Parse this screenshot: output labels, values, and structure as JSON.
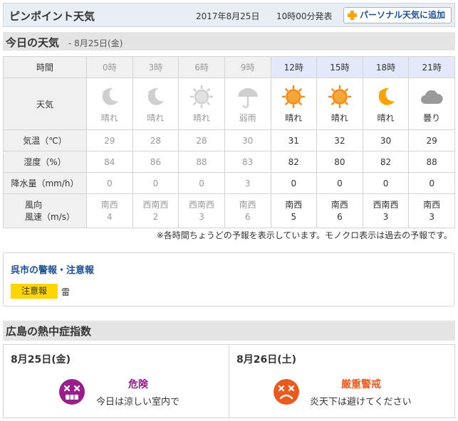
{
  "header": {
    "title": "ピンポイント天気",
    "date": "2017年8月25日",
    "issued": "10時00分発表",
    "personal_button": "パーソナル天気に追加"
  },
  "today": {
    "title": "今日の天気",
    "date": "- 8月25日(金)"
  },
  "table": {
    "labels": {
      "time": "時間",
      "weather": "天気",
      "temp": "気温（℃）",
      "humidity": "湿度（%）",
      "precip": "降水量（mm/h）",
      "wind_dir": "風向",
      "wind_speed": "風速（m/s）"
    },
    "hours": [
      {
        "time": "0時",
        "icon": "moon-night-icon",
        "weather": "晴れ",
        "temp": "29",
        "humidity": "84",
        "precip": "0",
        "wind_dir": "南西",
        "wind_speed": "4",
        "current": false
      },
      {
        "time": "3時",
        "icon": "moon-night-icon",
        "weather": "晴れ",
        "temp": "28",
        "humidity": "86",
        "precip": "0",
        "wind_dir": "西南西",
        "wind_speed": "2",
        "current": false
      },
      {
        "time": "6時",
        "icon": "sun-icon",
        "weather": "晴れ",
        "temp": "28",
        "humidity": "88",
        "precip": "0",
        "wind_dir": "西南西",
        "wind_speed": "3",
        "current": false
      },
      {
        "time": "9時",
        "icon": "umbrella-icon",
        "weather": "弱雨",
        "temp": "30",
        "humidity": "83",
        "precip": "3",
        "wind_dir": "南西",
        "wind_speed": "6",
        "current": false
      },
      {
        "time": "12時",
        "icon": "sun-icon",
        "weather": "晴れ",
        "temp": "31",
        "humidity": "82",
        "precip": "0",
        "wind_dir": "南西",
        "wind_speed": "5",
        "current": true
      },
      {
        "time": "15時",
        "icon": "sun-icon",
        "weather": "晴れ",
        "temp": "32",
        "humidity": "80",
        "precip": "0",
        "wind_dir": "南西",
        "wind_speed": "6",
        "current": true
      },
      {
        "time": "18時",
        "icon": "moon-night-icon",
        "weather": "晴れ",
        "temp": "30",
        "humidity": "82",
        "precip": "0",
        "wind_dir": "西南西",
        "wind_speed": "3",
        "current": true
      },
      {
        "time": "21時",
        "icon": "cloud-icon",
        "weather": "曇り",
        "temp": "29",
        "humidity": "88",
        "precip": "0",
        "wind_dir": "南西",
        "wind_speed": "3",
        "current": true
      }
    ],
    "note": "※各時間ちょうどの予報を表示しています。モノクロ表示は過去の予報です。"
  },
  "warning": {
    "title": "呉市の警報・注意報",
    "badge": "注意報",
    "item": "雷"
  },
  "heat": {
    "title": "広島の熱中症指数",
    "days": [
      {
        "date": "8月25日(金)",
        "icon": "dizzy-face-icon",
        "level": "危険",
        "message": "今日は涼しい室内で",
        "color": "#9a1d8c"
      },
      {
        "date": "8月26日(土)",
        "icon": "sad-face-icon",
        "level": "厳重警戒",
        "message": "炎天下は避けてください",
        "color": "#e85a1e"
      }
    ]
  },
  "colors": {
    "sun": "#f28a1c",
    "moon": "#f5a400",
    "past_icon": "#c8c8c8",
    "cloud": "#9a9a9a",
    "highlight_header": "#e4e9f9",
    "brand_blue": "#1d4f91",
    "badge_yellow": "#ffd600"
  }
}
